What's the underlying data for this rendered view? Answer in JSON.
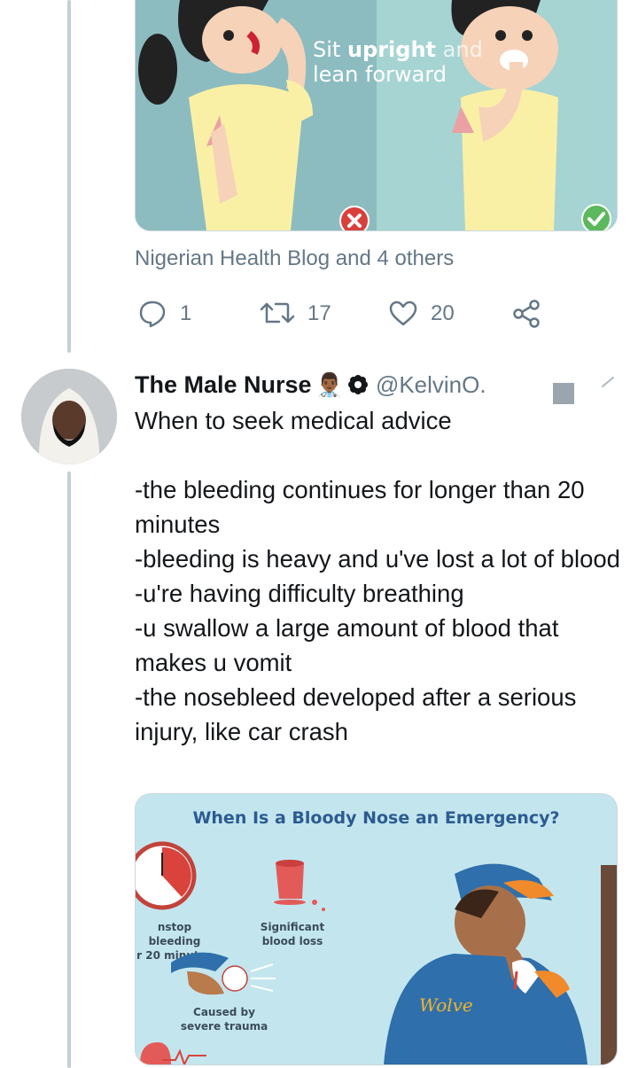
{
  "top_media": {
    "caption_bold": "upright",
    "caption_prefix": "Sit ",
    "caption_suffix": " and",
    "caption_line2": "lean forward",
    "wrong_badge": "x-icon",
    "right_badge": "checkmark-icon"
  },
  "liked_by": "Nigerian Health Blog and 4 others",
  "actions": {
    "reply_count": "1",
    "retweet_count": "17",
    "like_count": "20"
  },
  "tweet": {
    "author_name": "The Male Nurse",
    "author_emoji": "👨🏾‍⚕️",
    "handle": "@KelvinO.",
    "text": "When to seek medical advice\n\n-the bleeding continues for longer than 20 minutes\n-bleeding is heavy and u've lost a lot of blood\n-u're having difficulty breathing\n-u swallow a large amount of blood that makes u vomit\n-the nosebleed developed after a serious injury, like car crash"
  },
  "infographic": {
    "title": "When Is a Bloody Nose an Emergency?",
    "label_stop": "nstop bleeding\nr 20 minutes",
    "label_blood": "Significant\nblood loss",
    "label_trauma": "Caused by\nsevere trauma",
    "jersey_text": "Wolve"
  },
  "colors": {
    "thread_line": "#c4cfd6",
    "secondary_text": "#657786",
    "infographic_bg": "#c3e6ee",
    "title_blue": "#2c5b91"
  }
}
